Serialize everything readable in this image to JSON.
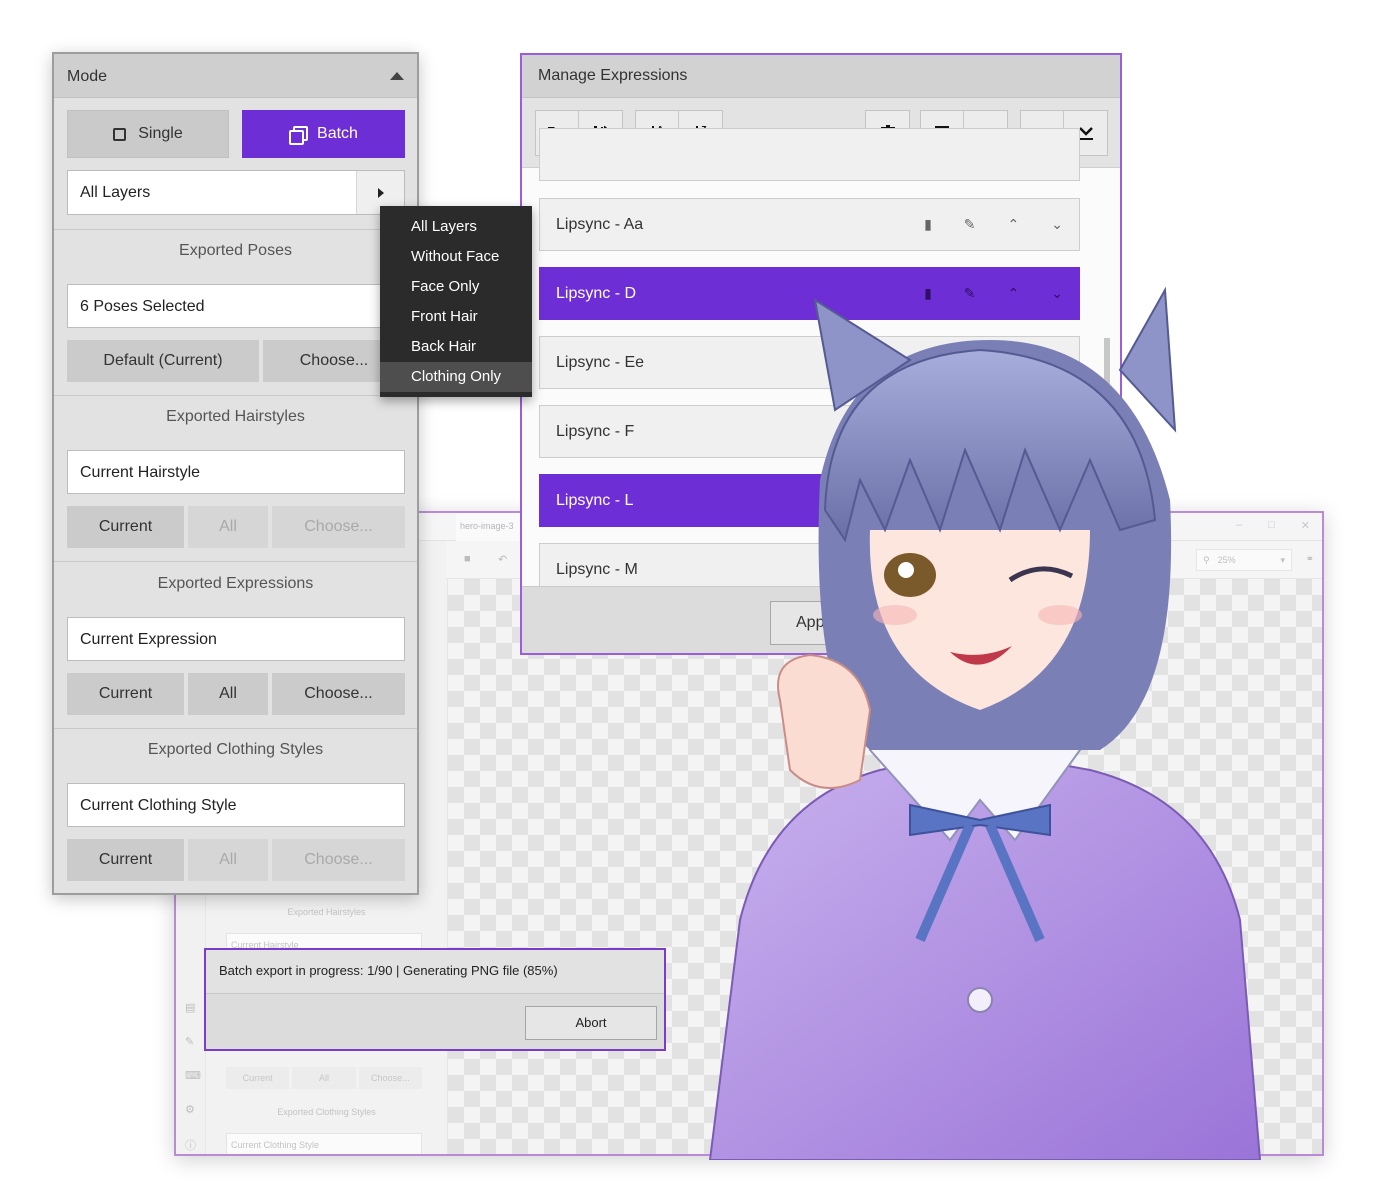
{
  "editor": {
    "file_tab": "hero-image-3",
    "zoom": "25%",
    "ghost": {
      "hairstyles_label": "Exported Hairstyles",
      "hairstyle_value": "Current Hairstyle",
      "buttons": [
        "Current",
        "All",
        "Choose..."
      ],
      "clothing_label": "Exported Clothing Styles",
      "clothing_value": "Current Clothing Style"
    }
  },
  "progress": {
    "message": "Batch export in progress: 1/90 | Generating PNG file (85%)",
    "percent": 85,
    "current": 1,
    "total": 90,
    "abort_label": "Abort"
  },
  "mode_panel": {
    "title": "Mode",
    "single_label": "Single",
    "batch_label": "Batch",
    "layer_select": "All Layers",
    "poses": {
      "title": "Exported Poses",
      "value": "6 Poses Selected",
      "default_label": "Default (Current)",
      "choose_label": "Choose..."
    },
    "hairstyles": {
      "title": "Exported Hairstyles",
      "value": "Current Hairstyle",
      "current": "Current",
      "all": "All",
      "choose": "Choose..."
    },
    "expressions": {
      "title": "Exported Expressions",
      "value": "Current Expression",
      "current": "Current",
      "all": "All",
      "choose": "Choose..."
    },
    "clothing": {
      "title": "Exported Clothing Styles",
      "value": "Current Clothing Style",
      "current": "Current",
      "all": "All",
      "choose": "Choose..."
    }
  },
  "dropdown": {
    "options": [
      "All Layers",
      "Without Face",
      "Face Only",
      "Front Hair",
      "Back Hair",
      "Clothing Only"
    ],
    "highlighted": "Clothing Only"
  },
  "manage": {
    "title": "Manage Expressions",
    "items": [
      {
        "label": "Lipsync - Aa",
        "selected": false
      },
      {
        "label": "Lipsync - D",
        "selected": true
      },
      {
        "label": "Lipsync - Ee",
        "selected": false
      },
      {
        "label": "Lipsync - F",
        "selected": false
      },
      {
        "label": "Lipsync - L",
        "selected": true
      },
      {
        "label": "Lipsync - M",
        "selected": false
      }
    ],
    "apply_label": "Apply"
  },
  "colors": {
    "accent": "#6e2ed6",
    "window_border": "#9b5ed8",
    "menu_bg": "#2b2b2b"
  }
}
